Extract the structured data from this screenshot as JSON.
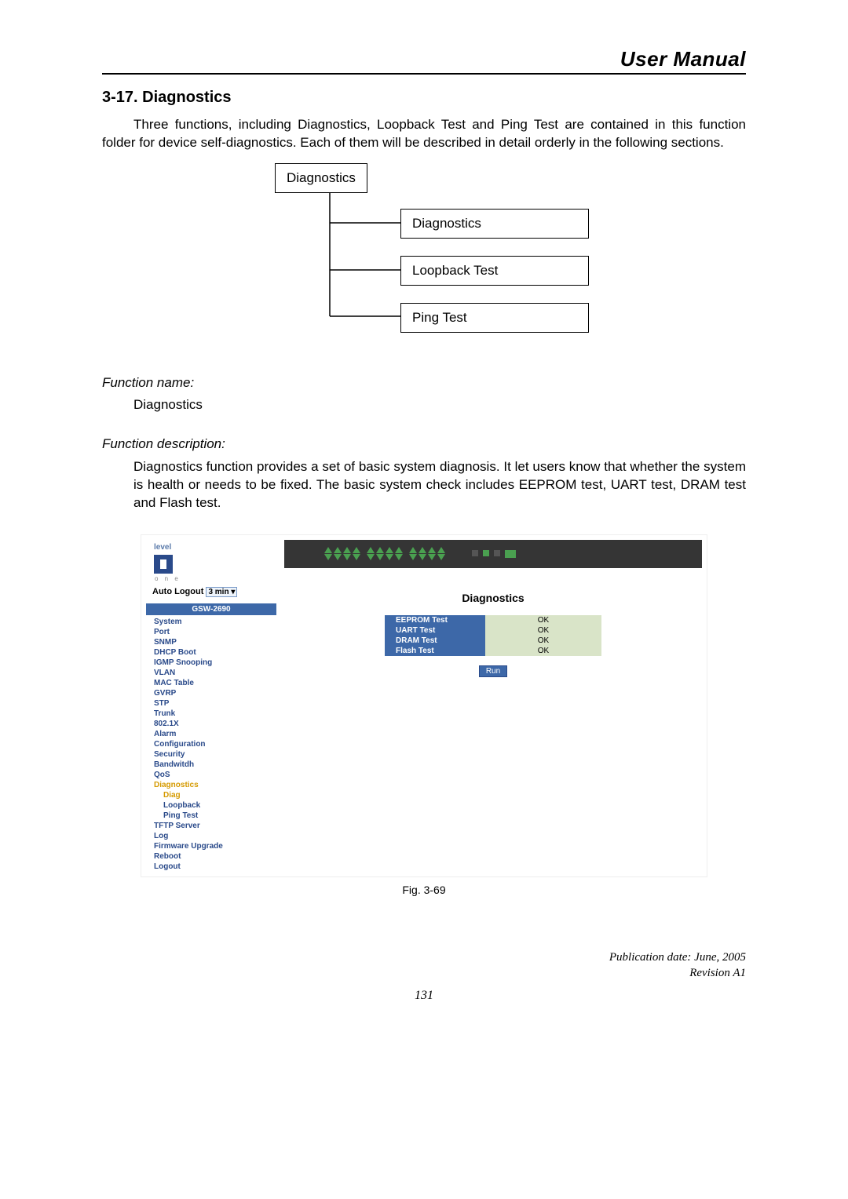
{
  "header": {
    "title": "User Manual"
  },
  "section": {
    "heading": "3-17. Diagnostics"
  },
  "intro": "Three functions, including Diagnostics, Loopback Test and Ping Test are contained in this function folder for device self-diagnostics. Each of them will be described in detail orderly in the following sections.",
  "tree": {
    "root": "Diagnostics",
    "children": [
      "Diagnostics",
      "Loopback Test",
      "Ping Test"
    ]
  },
  "function_name": {
    "label": "Function name:",
    "value": "Diagnostics"
  },
  "function_desc": {
    "label": "Function description:",
    "value": "Diagnostics function provides a set of basic system diagnosis. It let users know that whether the system is health or needs to be fixed. The basic system check includes EEPROM test, UART test, DRAM test and Flash test."
  },
  "screenshot": {
    "logo_text": "level",
    "one": "o n e",
    "auto_logout_label": "Auto Logout",
    "auto_logout_value": "3 min",
    "model": "GSW-2690",
    "nav": [
      "System",
      "Port",
      "SNMP",
      "DHCP Boot",
      "IGMP Snooping",
      "VLAN",
      "MAC Table",
      "GVRP",
      "STP",
      "Trunk",
      "802.1X",
      "Alarm",
      "Configuration",
      "Security",
      "Bandwitdh",
      "QoS"
    ],
    "nav_diag": "Diagnostics",
    "nav_diag_children": [
      "Diag",
      "Loopback",
      "Ping Test"
    ],
    "nav_diag_active": "Diag",
    "nav_after": [
      "TFTP Server",
      "Log",
      "Firmware Upgrade",
      "Reboot",
      "Logout"
    ],
    "content_title": "Diagnostics",
    "tests": [
      {
        "name": "EEPROM Test",
        "result": "OK"
      },
      {
        "name": "UART Test",
        "result": "OK"
      },
      {
        "name": "DRAM Test",
        "result": "OK"
      },
      {
        "name": "Flash Test",
        "result": "OK"
      }
    ],
    "run_button": "Run"
  },
  "figure_caption": "Fig. 3-69",
  "publication": {
    "date": "Publication date: June, 2005",
    "revision": "Revision A1"
  },
  "page_number": "131"
}
